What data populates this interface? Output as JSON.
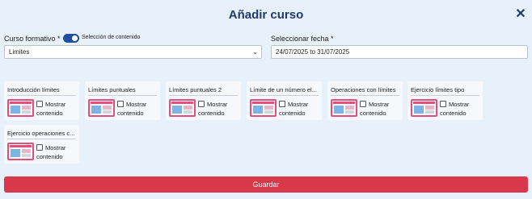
{
  "header": {
    "title": "Añadir curso",
    "close_glyph": "✕"
  },
  "form": {
    "curso_label": "Curso formativo *",
    "toggle_label": "Selección de contenido",
    "toggle_on": true,
    "curso_value": "Limites",
    "fecha_label": "Seleccionar fecha *",
    "fecha_value": "24/07/2025 to 31/07/2025"
  },
  "contents": [
    {
      "title": "Introducción límites",
      "check_label_1": "Mostrar",
      "check_label_2": "contenido"
    },
    {
      "title": "Límites puntuales",
      "check_label_1": "Mostrar",
      "check_label_2": "contenido"
    },
    {
      "title": "Límites puntuales 2",
      "check_label_1": "Mostrar",
      "check_label_2": "contenido"
    },
    {
      "title": "Límite de un número el...",
      "check_label_1": "Mostrar",
      "check_label_2": "contenido"
    },
    {
      "title": "Operaciones con límites",
      "check_label_1": "Mostrar",
      "check_label_2": "contenido"
    },
    {
      "title": "Ejercicio límites tipo",
      "check_label_1": "Mostrar",
      "check_label_2": "contenido"
    },
    {
      "title": "Ejercicio operaciones c...",
      "check_label_1": "Mostrar",
      "check_label_2": "contenido"
    }
  ],
  "actions": {
    "save_label": "Guardar"
  },
  "colors": {
    "accent": "#1e3a6e",
    "toggle": "#1f4fa0",
    "save": "#d8394a",
    "thumb_border": "#e0507a"
  }
}
